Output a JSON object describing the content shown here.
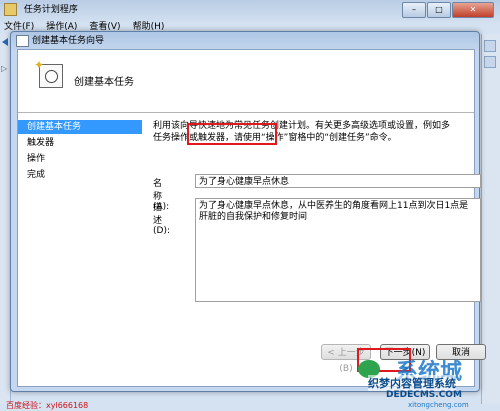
{
  "parent_window": {
    "title": "任务计划程序",
    "menu": [
      "文件(F)",
      "操作(A)",
      "查看(V)",
      "帮助(H)"
    ]
  },
  "dialog": {
    "title": "创建基本任务向导",
    "header_title": "创建基本任务",
    "steps": [
      "创建基本任务",
      "触发器",
      "操作",
      "完成"
    ],
    "active_step": 0,
    "description": "利用该向导快速地为常见任务创建计划。有关更多高级选项或设置，例如多任务操作或触发器，请使用“操作”窗格中的“创建任务”命令。",
    "name_label": "名称(A):",
    "name_value": "为了身心健康早点休息",
    "desc_label": "描述(D):",
    "desc_value": "为了身心健康早点休息，从中医养生的角度看网上11点到次日1点是肝脏的自我保护和修复时间",
    "buttons": {
      "back": "< 上一步(B)",
      "next": "下一步(N) >",
      "cancel": "取消"
    }
  },
  "watermarks": {
    "left_text": "百度经验：xyl666168",
    "logo_big": "系统城",
    "logo_line1": "织梦内容管理系统",
    "logo_line2": "DEDECMS.COM",
    "logo_line3": "xitongcheng.com"
  },
  "colors": {
    "selection": "#3399ff",
    "highlight_box": "#e0191e"
  }
}
